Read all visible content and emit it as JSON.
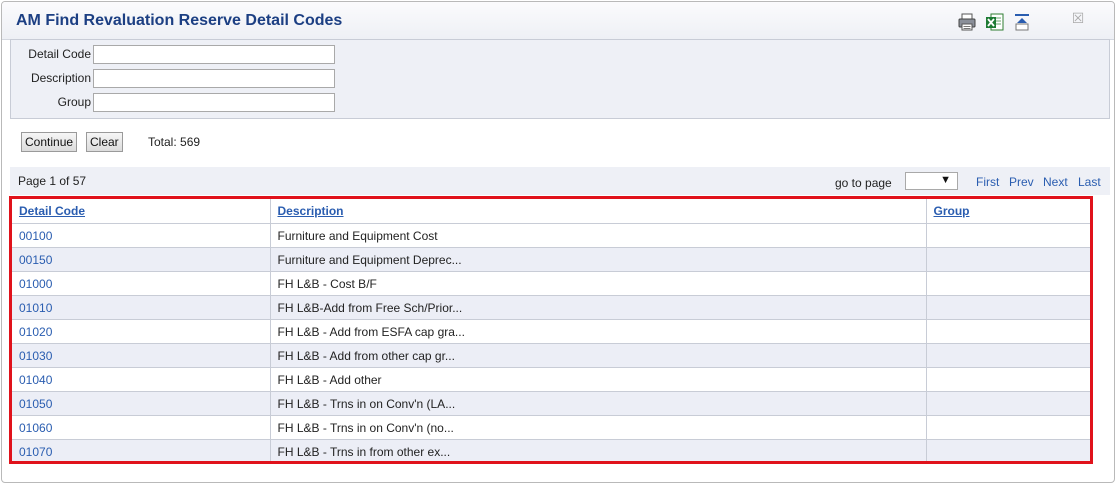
{
  "window": {
    "title": "AM Find Revaluation Reserve Detail Codes",
    "toolbar_icons": [
      "print-icon",
      "excel-export-icon",
      "collapse-icon"
    ],
    "close_glyph": "☒"
  },
  "criteria": {
    "detail_code_label": "Detail Code",
    "detail_code_value": "",
    "description_label": "Description",
    "description_value": "",
    "group_label": "Group",
    "group_value": ""
  },
  "actions": {
    "continue_label": "Continue",
    "clear_label": "Clear",
    "total_text": "Total: 569"
  },
  "pager": {
    "page_info": "Page 1 of 57",
    "goto_label": "go to page",
    "goto_value": "",
    "goto_arrow": "▼",
    "first": "First",
    "prev": "Prev",
    "next": "Next",
    "last": "Last"
  },
  "grid": {
    "columns": [
      "Detail Code",
      "Description",
      "Group"
    ],
    "rows": [
      {
        "code": "00100",
        "description": "Furniture and Equipment Cost",
        "group": ""
      },
      {
        "code": "00150",
        "description": "Furniture and Equipment Deprec...",
        "group": ""
      },
      {
        "code": "01000",
        "description": "FH L&B - Cost B/F",
        "group": ""
      },
      {
        "code": "01010",
        "description": "FH L&B-Add from Free Sch/Prior...",
        "group": ""
      },
      {
        "code": "01020",
        "description": "FH L&B - Add from ESFA cap gra...",
        "group": ""
      },
      {
        "code": "01030",
        "description": "FH L&B - Add from other cap gr...",
        "group": ""
      },
      {
        "code": "01040",
        "description": "FH L&B - Add other",
        "group": ""
      },
      {
        "code": "01050",
        "description": "FH L&B - Trns in on Conv'n (LA...",
        "group": ""
      },
      {
        "code": "01060",
        "description": "FH L&B - Trns in on Conv'n (no...",
        "group": ""
      },
      {
        "code": "01070",
        "description": "FH L&B - Trns in from other ex...",
        "group": ""
      }
    ]
  },
  "colors": {
    "title": "#1c3f83",
    "link": "#2a5db0",
    "highlight_border": "#e0121b",
    "panel_bg": "#eef0f6"
  }
}
